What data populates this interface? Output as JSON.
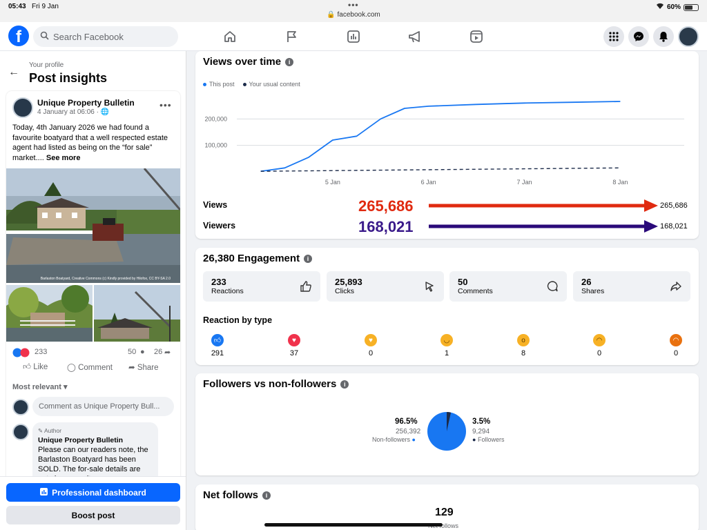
{
  "status_bar": {
    "time": "05:43",
    "date": "Fri 9 Jan",
    "url": "facebook.com",
    "battery": "60%"
  },
  "topnav": {
    "search_placeholder": "Search Facebook"
  },
  "left": {
    "breadcrumb": "Your profile",
    "title": "Post insights",
    "post": {
      "author": "Unique Property Bulletin",
      "date": "4 January at 06:06 ·",
      "text": "Today, 4th January 2026 we had found a favourite boatyard that a well respected estate agent had listed as being on the “for sale” market....",
      "see_more": "See more",
      "image_caption": "Barlaston Boatyard, Creative Commons (c) Kindly provided by Hilofox, CC BY-SA 2.0",
      "reactions_count": "233",
      "comments_count": "50",
      "shares_count": "26",
      "like_label": "Like",
      "comment_label": "Comment",
      "share_label": "Share",
      "most_relevant": "Most relevant",
      "comment_placeholder": "Comment as Unique Property Bull...",
      "comment": {
        "badge": "Author",
        "name": "Unique Property Bulletin",
        "text": "Please can our readers note, the Barlaston Boatyard has been SOLD. The for-sale details are not shown, as it"
      }
    },
    "professional_dashboard": "Professional dashboard",
    "boost_post": "Boost post"
  },
  "views_card": {
    "title": "Views over time",
    "legend": {
      "this_post": "This post",
      "usual": "Your usual content"
    },
    "views_label": "Views",
    "views_value": "265,686",
    "views_end": "265,686",
    "viewers_label": "Viewers",
    "viewers_value": "168,021",
    "viewers_end": "168,021"
  },
  "engagement": {
    "title": "26,380 Engagement",
    "boxes": [
      {
        "value": "233",
        "label": "Reactions"
      },
      {
        "value": "25,893",
        "label": "Clicks"
      },
      {
        "value": "50",
        "label": "Comments"
      },
      {
        "value": "26",
        "label": "Shares"
      }
    ],
    "reaction_title": "Reaction by type",
    "reactions": [
      "291",
      "37",
      "0",
      "1",
      "8",
      "0",
      "0"
    ]
  },
  "followers": {
    "title": "Followers vs non-followers",
    "non_pct": "96.5%",
    "non_count": "256,392",
    "non_label": "Non-followers",
    "fol_pct": "3.5%",
    "fol_count": "9,294",
    "fol_label": "Followers"
  },
  "net_follows": {
    "title": "Net follows",
    "value": "129",
    "label": "Net follows"
  },
  "chart_data": {
    "type": "line",
    "title": "Views over time",
    "xlabel": "",
    "ylabel": "",
    "x_ticks": [
      "5 Jan",
      "6 Jan",
      "7 Jan",
      "8 Jan"
    ],
    "y_ticks": [
      100000,
      200000
    ],
    "ylim": [
      0,
      300000
    ],
    "grid": true,
    "series": [
      {
        "name": "This post",
        "color": "#1877f2",
        "x": [
          "4 Jan 06:00",
          "4 Jan 12:00",
          "4 Jan 18:00",
          "5 Jan 00:00",
          "5 Jan 06:00",
          "5 Jan 12:00",
          "5 Jan 18:00",
          "6 Jan 00:00",
          "6 Jan 12:00",
          "7 Jan 00:00",
          "7 Jan 12:00",
          "8 Jan 00:00"
        ],
        "values": [
          2000,
          15000,
          55000,
          120000,
          135000,
          200000,
          240000,
          248000,
          255000,
          260000,
          263000,
          266000
        ]
      },
      {
        "name": "Your usual content",
        "color": "#1c2b4a",
        "dashed": true,
        "x": [
          "4 Jan 06:00",
          "8 Jan 00:00"
        ],
        "values": [
          2000,
          15000
        ]
      }
    ]
  }
}
